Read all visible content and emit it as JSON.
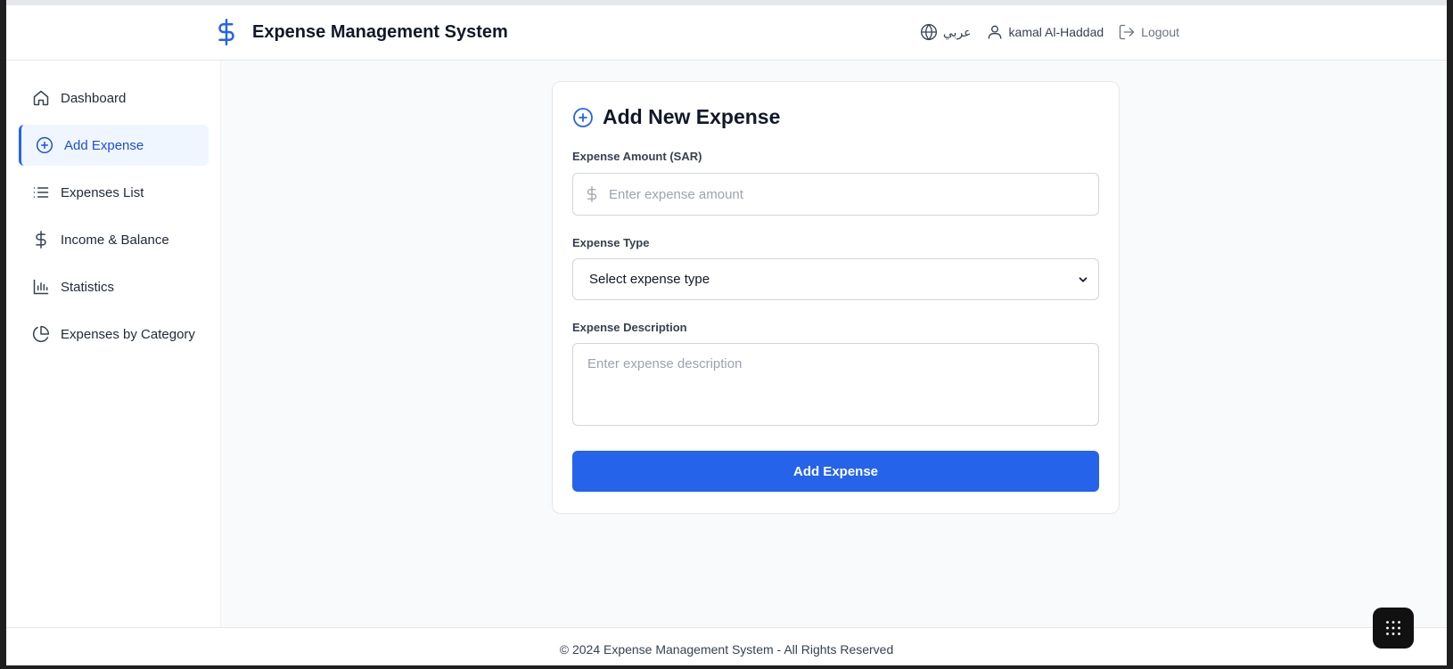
{
  "header": {
    "title": "Expense Management System",
    "language": "عربي",
    "user_name": "kamal Al-Haddad",
    "logout_label": "Logout"
  },
  "sidebar": {
    "items": [
      {
        "label": "Dashboard",
        "icon": "home-icon",
        "active": false
      },
      {
        "label": "Add Expense",
        "icon": "plus-circle-icon",
        "active": true
      },
      {
        "label": "Expenses List",
        "icon": "list-icon",
        "active": false
      },
      {
        "label": "Income & Balance",
        "icon": "dollar-icon",
        "active": false
      },
      {
        "label": "Statistics",
        "icon": "bar-chart-icon",
        "active": false
      },
      {
        "label": "Expenses by Category",
        "icon": "pie-chart-icon",
        "active": false
      }
    ]
  },
  "form": {
    "title": "Add New Expense",
    "amount_label": "Expense Amount (SAR)",
    "amount_placeholder": "Enter expense amount",
    "amount_value": "",
    "type_label": "Expense Type",
    "type_selected": "Select expense type",
    "description_label": "Expense Description",
    "description_placeholder": "Enter expense description",
    "description_value": "",
    "submit_label": "Add Expense"
  },
  "footer": {
    "text": "© 2024 Expense Management System - All Rights Reserved"
  },
  "colors": {
    "accent": "#2563eb",
    "active_bg": "#eff6ff",
    "main_bg": "#f9fafb"
  }
}
